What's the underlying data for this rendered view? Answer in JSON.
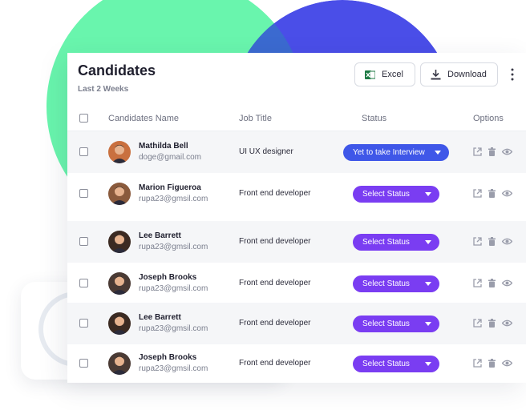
{
  "header": {
    "title": "Candidates",
    "subtitle": "Last 2 Weeks",
    "excel_label": "Excel",
    "download_label": "Download"
  },
  "columns": {
    "select_all": "",
    "name": "Candidates Name",
    "job": "Job Title",
    "status": "Status",
    "options": "Options"
  },
  "rows": [
    {
      "name": "Mathilda Bell",
      "email": "doge@gmail.com",
      "job": "UI UX designer",
      "status": "Yet to take Interview",
      "status_type": "interview"
    },
    {
      "name": "Marion Figueroa",
      "email": "rupa23@gmsil.com",
      "job": "Front end developer",
      "status": "Select Status",
      "status_type": "select"
    },
    {
      "name": "Lee Barrett",
      "email": "rupa23@gmsil.com",
      "job": "Front end developer",
      "status": "Select Status",
      "status_type": "select"
    },
    {
      "name": "Joseph Brooks",
      "email": "rupa23@gmsil.com",
      "job": "Front end developer",
      "status": "Select Status",
      "status_type": "select"
    },
    {
      "name": "Lee Barrett",
      "email": "rupa23@gmsil.com",
      "job": "Front end developer",
      "status": "Select Status",
      "status_type": "select"
    },
    {
      "name": "Joseph Brooks",
      "email": "rupa23@gmsil.com",
      "job": "Front end developer",
      "status": "Select Status",
      "status_type": "select"
    }
  ],
  "row_icons": [
    "external-link-icon",
    "trash-icon",
    "eye-icon"
  ],
  "colors": {
    "accent_blue": "#3f57e8",
    "accent_purple": "#7a3df2",
    "blob_green": "#69f5ad",
    "blob_blue": "#4a4ee8",
    "dial_orange": "#f48a4b",
    "excel_green": "#1d7a43"
  }
}
